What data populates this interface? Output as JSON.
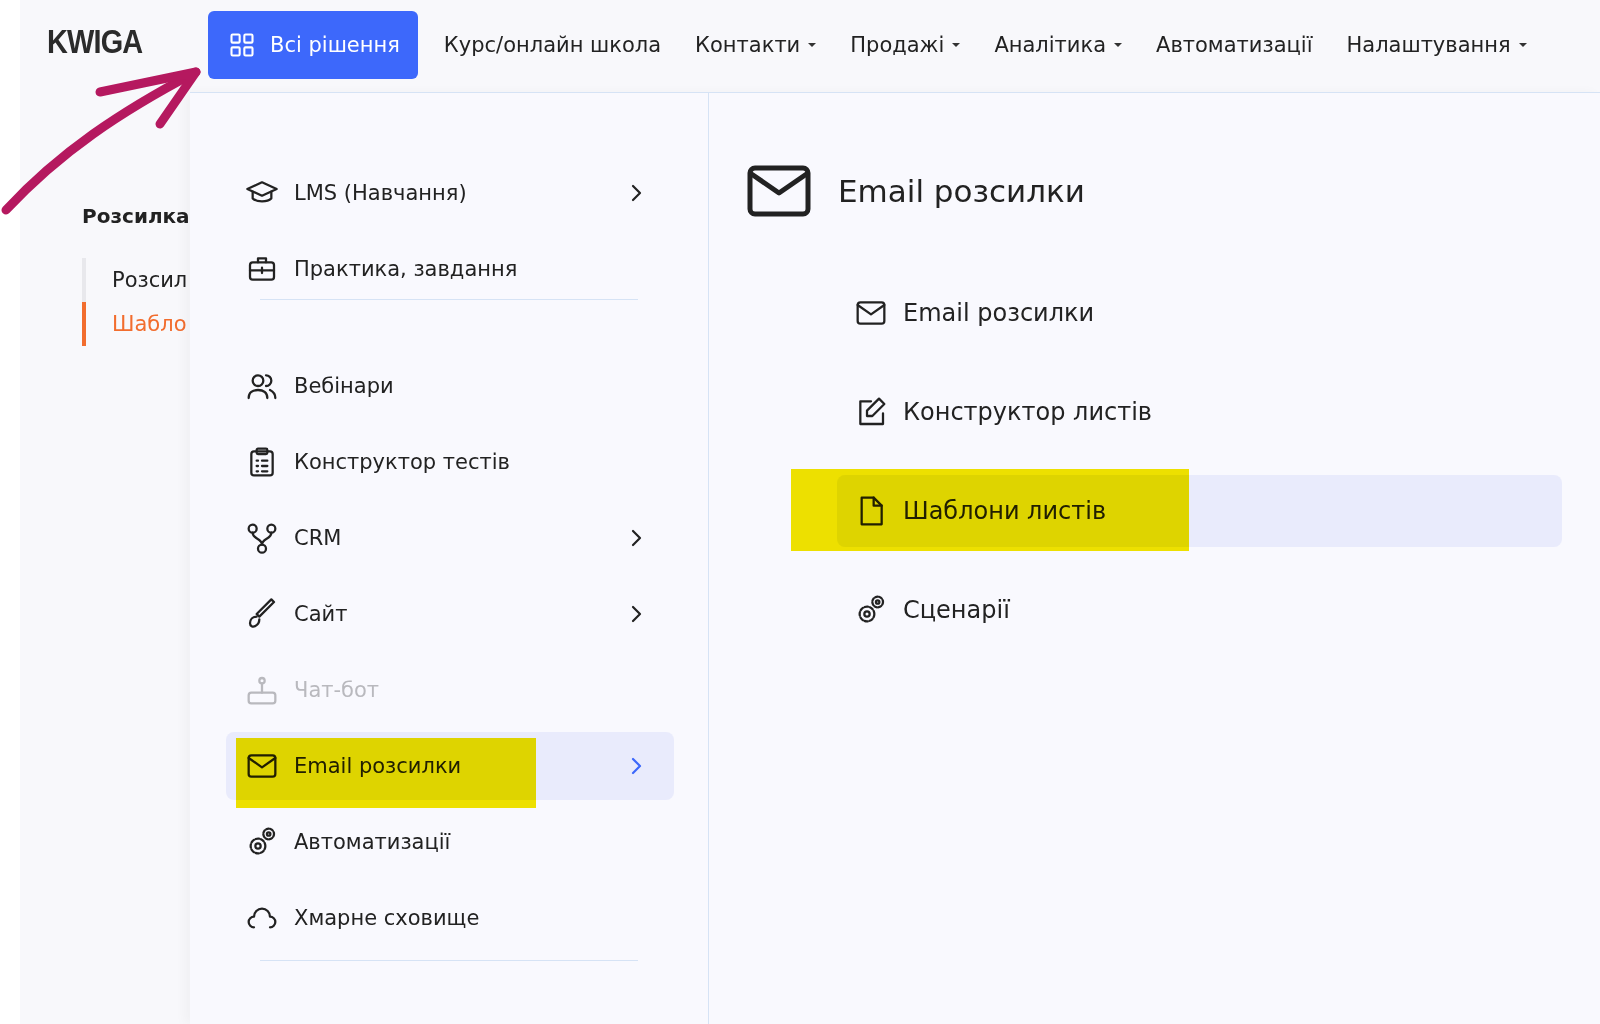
{
  "logo": "KWIGA",
  "nav": [
    {
      "label": "Всі рішення",
      "kind": "primary",
      "dropdown": false
    },
    {
      "label": "Курс/онлайн школа",
      "kind": "link",
      "dropdown": false
    },
    {
      "label": "Контакти",
      "kind": "link",
      "dropdown": true
    },
    {
      "label": "Продажі",
      "kind": "link",
      "dropdown": true
    },
    {
      "label": "Аналітика",
      "kind": "link",
      "dropdown": true
    },
    {
      "label": "Автоматизації",
      "kind": "link",
      "dropdown": false
    },
    {
      "label": "Налаштування",
      "kind": "link",
      "dropdown": true
    }
  ],
  "page_sidebar": {
    "title": "Розсилка",
    "items": [
      {
        "label": "Розсил",
        "selected": false
      },
      {
        "label": "Шабло",
        "selected": true
      }
    ]
  },
  "menu": {
    "groups": [
      [
        {
          "label": "LMS (Навчання)",
          "chevron": true,
          "selected": false,
          "disabled": false,
          "highlighted": false
        },
        {
          "label": "Практика, завдання",
          "chevron": false,
          "selected": false,
          "disabled": false,
          "highlighted": false
        }
      ],
      [
        {
          "label": "Вебінари",
          "chevron": false,
          "selected": false,
          "disabled": false,
          "highlighted": false
        },
        {
          "label": "Конструктор тестів",
          "chevron": false,
          "selected": false,
          "disabled": false,
          "highlighted": false
        },
        {
          "label": "CRM",
          "chevron": true,
          "selected": false,
          "disabled": false,
          "highlighted": false
        },
        {
          "label": "Сайт",
          "chevron": true,
          "selected": false,
          "disabled": false,
          "highlighted": false
        },
        {
          "label": "Чат-бот",
          "chevron": false,
          "selected": false,
          "disabled": true,
          "highlighted": false
        },
        {
          "label": "Email розсилки",
          "chevron": true,
          "selected": true,
          "disabled": false,
          "highlighted": true
        },
        {
          "label": "Автоматизації",
          "chevron": false,
          "selected": false,
          "disabled": false,
          "highlighted": false
        },
        {
          "label": "Хмарне сховище",
          "chevron": false,
          "selected": false,
          "disabled": false,
          "highlighted": false
        }
      ]
    ]
  },
  "submenu": {
    "title": "Email розсилки",
    "items": [
      {
        "label": "Email розсилки",
        "selected": false,
        "highlighted": false
      },
      {
        "label": "Конструктор листів",
        "selected": false,
        "highlighted": false
      },
      {
        "label": "Шаблони листів",
        "selected": true,
        "highlighted": true
      },
      {
        "label": "Сценарії",
        "selected": false,
        "highlighted": false
      }
    ]
  }
}
